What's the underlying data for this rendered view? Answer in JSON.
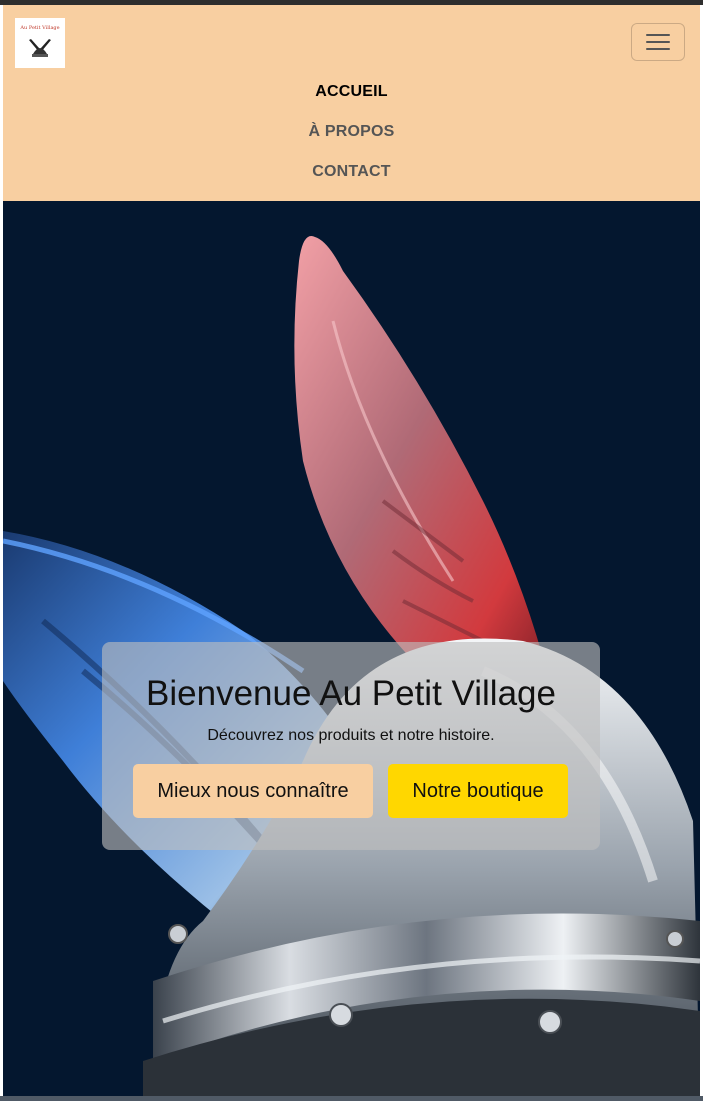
{
  "colors": {
    "navbar_bg": "#f8cfa1",
    "hero_bg": "#04172f",
    "shop_button": "#ffd700",
    "primary_button": "#f8cfa1"
  },
  "brand": {
    "logo_text": "Au Petit Village"
  },
  "nav": {
    "items": [
      {
        "label": "ACCUEIL",
        "active": true
      },
      {
        "label": "À PROPOS",
        "active": false
      },
      {
        "label": "CONTACT",
        "active": false
      }
    ]
  },
  "hero": {
    "title": "Bienvenue Au Petit Village",
    "subtitle": "Découvrez nos produits et notre histoire.",
    "primary_button": "Mieux nous connaître",
    "shop_button": "Notre boutique"
  }
}
